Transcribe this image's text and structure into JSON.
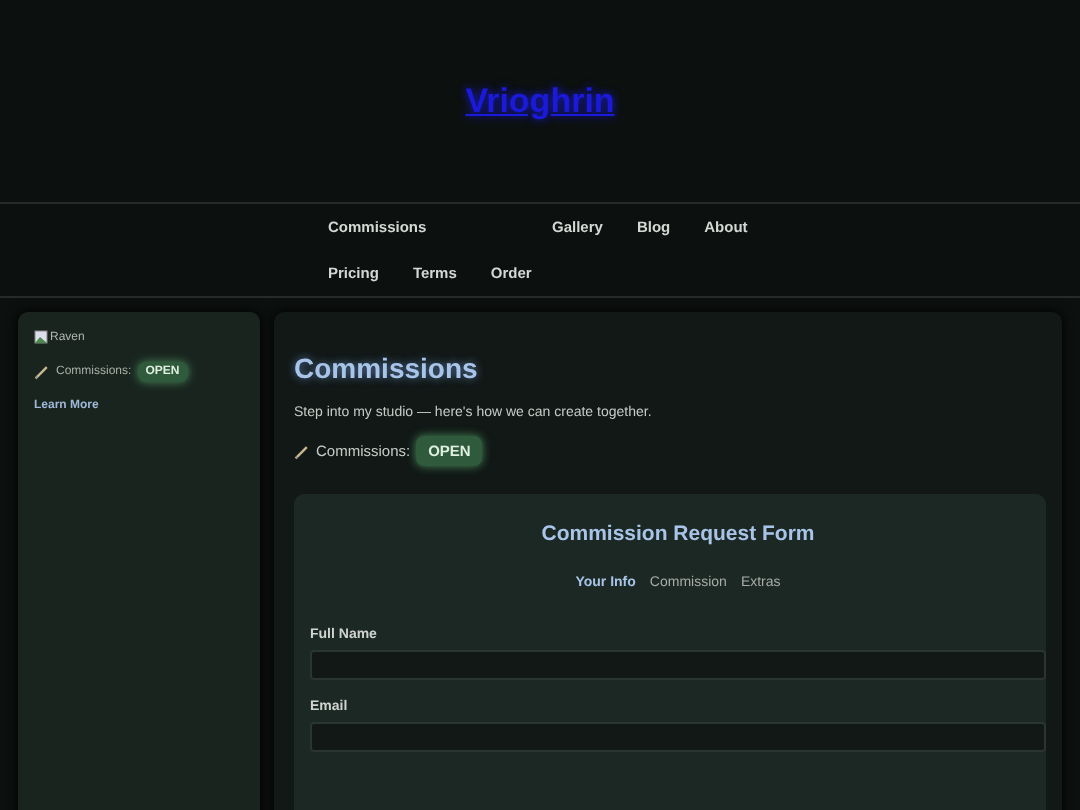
{
  "site_title": "Vrioghrin",
  "nav": [
    {
      "label": "Commissions",
      "kind": "wide"
    },
    {
      "label": "Gallery",
      "kind": "plain"
    },
    {
      "label": "Blog",
      "kind": "plain"
    },
    {
      "label": "About",
      "kind": "plain"
    },
    {
      "label": "Pricing",
      "kind": "plain"
    },
    {
      "label": "Terms",
      "kind": "plain"
    },
    {
      "label": "Order",
      "kind": "plain"
    }
  ],
  "sidebar": {
    "image_alt": "Raven",
    "status_label": "Commissions:",
    "status_badge": "OPEN",
    "link": "Learn More"
  },
  "main": {
    "heading": "Commissions",
    "intro": "Step into my studio — here's how we can create together.",
    "status_label": "Commissions:",
    "status_badge": "OPEN",
    "form": {
      "title": "Commission Request Form",
      "steps": [
        {
          "label": "Your Info",
          "selected": true
        },
        {
          "label": "Commission",
          "selected": false
        },
        {
          "label": "Extras",
          "selected": false
        }
      ],
      "fields": [
        {
          "label": "Full Name"
        },
        {
          "label": "Email"
        }
      ]
    }
  }
}
